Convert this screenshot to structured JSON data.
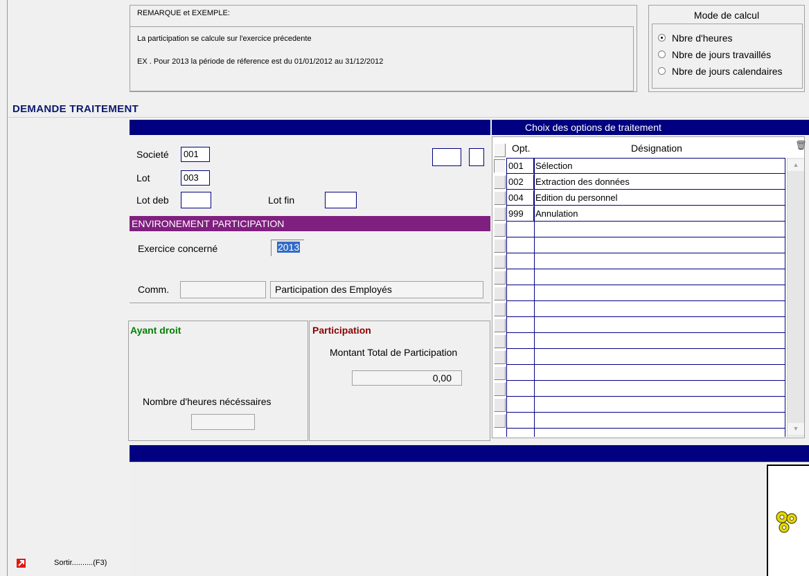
{
  "remark": {
    "title": "REMARQUE et EXEMPLE:",
    "line1": "La participation se calcule sur l'exercice précedente",
    "line2": "EX . Pour 2013 la période de réference est du 01/01/2012  au  31/12/2012"
  },
  "mode_calcul": {
    "title": "Mode de calcul",
    "options": [
      "Nbre d'heures",
      "Nbre de jours travaillés",
      "Nbre de jours calendaires"
    ],
    "selected": "Nbre d'heures"
  },
  "section_title": "DEMANDE TRAITEMENT",
  "fields": {
    "societe_label": "Societé",
    "societe_value": "001",
    "lot_label": "Lot",
    "lot_value": "003",
    "lot_deb_label": "Lot deb",
    "lot_deb_value": "",
    "lot_fin_label": "Lot fin",
    "lot_fin_value": ""
  },
  "environnement": {
    "header": "ENVIRONEMENT PARTICIPATION",
    "exercice_label": "Exercice concerné",
    "exercice_value": "2013",
    "comm_label": "Comm.",
    "comm_code": "",
    "comm_value": "Participation des Employés"
  },
  "ayant_droit": {
    "title": "Ayant droit",
    "heures_label": "Nombre d'heures nécéssaires",
    "heures_value": ""
  },
  "participation": {
    "title": "Participation",
    "montant_label": "Montant Total de Participation",
    "montant_value": "0,00"
  },
  "options_grid": {
    "header": "Choix des options de traitement",
    "col_opt": "Opt.",
    "col_designation": "Désignation",
    "rows": [
      {
        "code": "001",
        "label": "Sélection"
      },
      {
        "code": "002",
        "label": "Extraction des données"
      },
      {
        "code": "004",
        "label": "Edition du personnel"
      },
      {
        "code": "999",
        "label": "Annulation"
      }
    ]
  },
  "footer": {
    "exit_label": "Sortir..........(F3)"
  },
  "colors": {
    "navy": "#000080",
    "purple_header": "#7f1f7f",
    "green_title": "#008000",
    "red_title": "#8b0000",
    "exit_icon": "#e01818"
  }
}
